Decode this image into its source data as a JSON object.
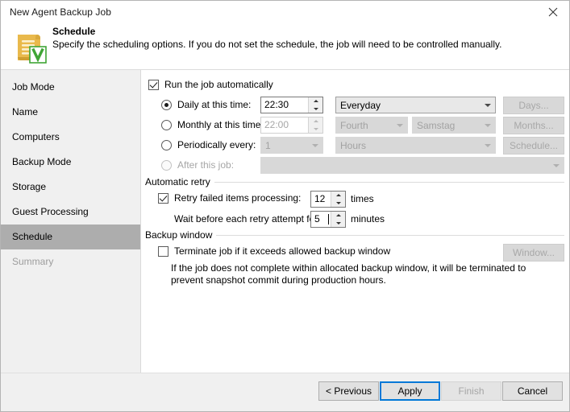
{
  "window": {
    "title": "New Agent Backup Job",
    "close_icon": "close-icon"
  },
  "header": {
    "icon": "schedule-scroll-icon",
    "title": "Schedule",
    "subtitle": "Specify the scheduling options. If you do not set the schedule, the job will need to be controlled manually."
  },
  "sidebar": {
    "items": [
      {
        "label": "Job Mode",
        "state": "normal"
      },
      {
        "label": "Name",
        "state": "normal"
      },
      {
        "label": "Computers",
        "state": "normal"
      },
      {
        "label": "Backup Mode",
        "state": "normal"
      },
      {
        "label": "Storage",
        "state": "normal"
      },
      {
        "label": "Guest Processing",
        "state": "normal"
      },
      {
        "label": "Schedule",
        "state": "selected"
      },
      {
        "label": "Summary",
        "state": "disabled"
      }
    ]
  },
  "main": {
    "run_auto": {
      "label": "Run the job automatically",
      "checked": true
    },
    "daily": {
      "radio_label": "Daily at this time:",
      "selected": true,
      "time": "22:30",
      "days_combo": "Everyday",
      "days_button": "Days..."
    },
    "monthly": {
      "radio_label": "Monthly at this time:",
      "selected": false,
      "time": "22:00",
      "ordinal_combo": "Fourth",
      "weekday_combo": "Samstag",
      "months_button": "Months..."
    },
    "periodically": {
      "radio_label": "Periodically every:",
      "selected": false,
      "interval_combo": "1",
      "unit_combo": "Hours",
      "schedule_button": "Schedule..."
    },
    "after_job": {
      "radio_label": "After this job:",
      "selected": false,
      "job_combo": ""
    },
    "automatic_retry": {
      "group_label": "Automatic retry",
      "retry_label": "Retry failed items processing:",
      "retry_checked": true,
      "retry_count": "12",
      "retry_count_unit": "times",
      "wait_label": "Wait before each retry attempt for:",
      "wait_value": "5",
      "wait_unit": "minutes"
    },
    "backup_window": {
      "group_label": "Backup window",
      "terminate_label": "Terminate job if it exceeds allowed backup window",
      "terminate_checked": false,
      "window_button": "Window...",
      "help_line1": "If the job does not complete within allocated backup window, it will be terminated to",
      "help_line2": "prevent snapshot commit during production hours."
    }
  },
  "footer": {
    "previous": "< Previous",
    "apply": "Apply",
    "finish": "Finish",
    "cancel": "Cancel"
  },
  "colors": {
    "accent": "#0078d7",
    "sidebar_bg": "#f0f0f0",
    "selected_nav": "#adadad",
    "icon_gold": "#e8b84b",
    "icon_green": "#3fa535"
  }
}
